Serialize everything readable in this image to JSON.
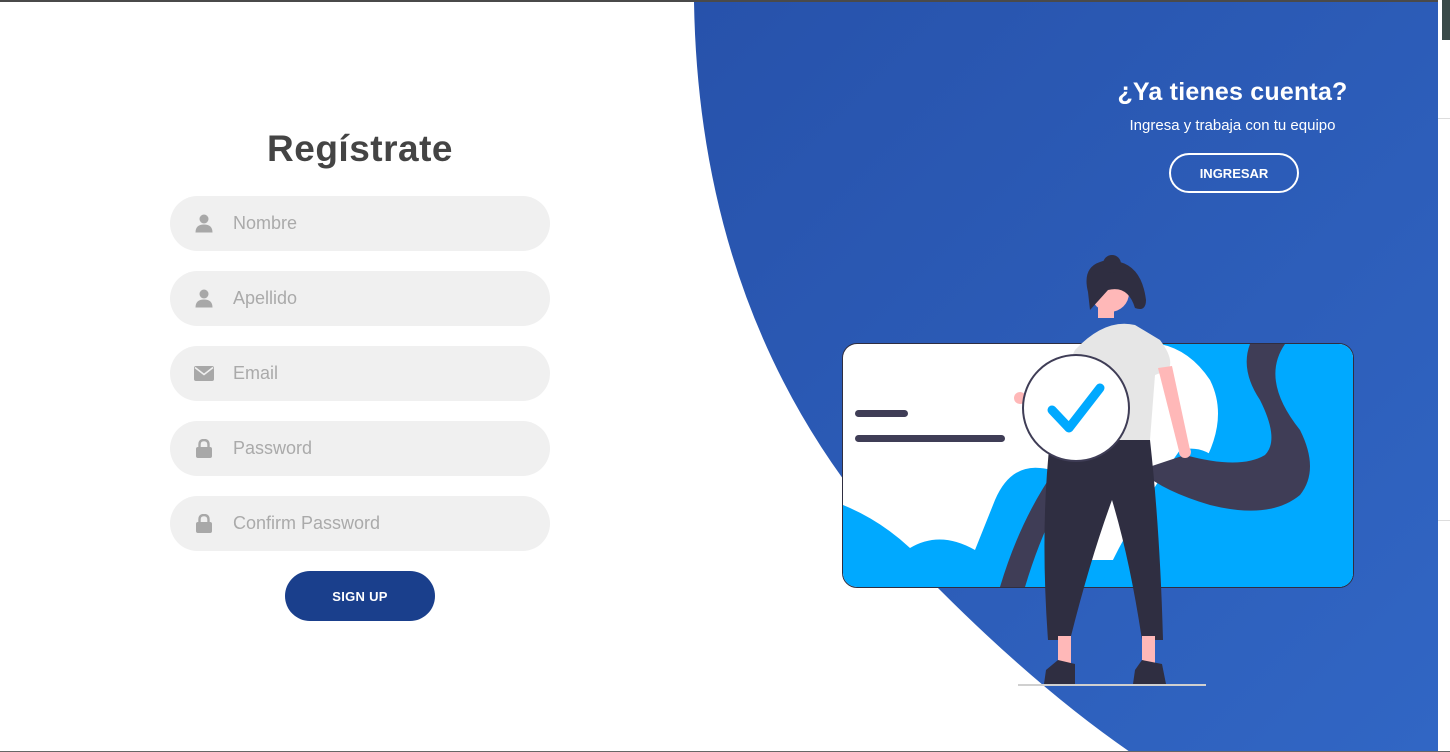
{
  "register": {
    "title": "Regístrate",
    "fields": [
      {
        "placeholder": "Nombre",
        "icon": "user-icon"
      },
      {
        "placeholder": "Apellido",
        "icon": "user-icon"
      },
      {
        "placeholder": "Email",
        "icon": "envelope-icon"
      },
      {
        "placeholder": "Password",
        "icon": "lock-icon"
      },
      {
        "placeholder": "Confirm Password",
        "icon": "lock-icon"
      }
    ],
    "submit_label": "SIGN UP"
  },
  "login_panel": {
    "title": "¿Ya tienes cuenta?",
    "subtitle": "Ingresa y trabaja con tu equipo",
    "button_label": "INGRESAR"
  },
  "colors": {
    "panel_blue": "#2c5bb3",
    "button_dark_blue": "#1a3f8c",
    "field_bg": "#f0f0f0",
    "accent_cyan": "#00a9ff"
  }
}
